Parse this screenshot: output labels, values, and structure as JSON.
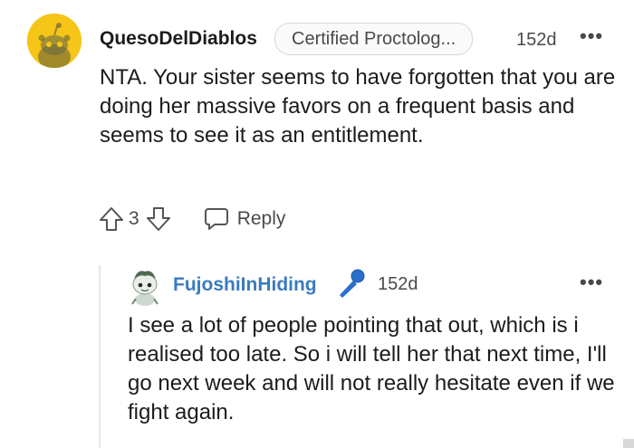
{
  "comment": {
    "username": "QuesoDelDiablos",
    "flair": "Certified Proctolog...",
    "age": "152d",
    "more": "•••",
    "body": "NTA. Your sister seems to have forgotten that you are doing her massive favors on a frequent basis and seems to see it as an entitlement.",
    "vote_count": "3",
    "reply_label": "Reply"
  },
  "reply": {
    "username": "FujoshiInHiding",
    "age": "152d",
    "more": "•••",
    "body": "I see a lot of people pointing that out, which is i realised too late. So i will tell her that next time, I'll go next week and will not really hesitate even if we fight again."
  },
  "icons": {
    "avatar1": "snoo-avatar-icon",
    "avatar2": "snoo-avatar-icon",
    "upvote": "upvote-arrow-icon",
    "downvote": "downvote-arrow-icon",
    "reply": "speech-bubble-icon",
    "award": "microphone-icon"
  },
  "colors": {
    "avatar1_bg": "#f5c518",
    "username2": "#3b7bbf",
    "mic": "#2a6fc9"
  }
}
